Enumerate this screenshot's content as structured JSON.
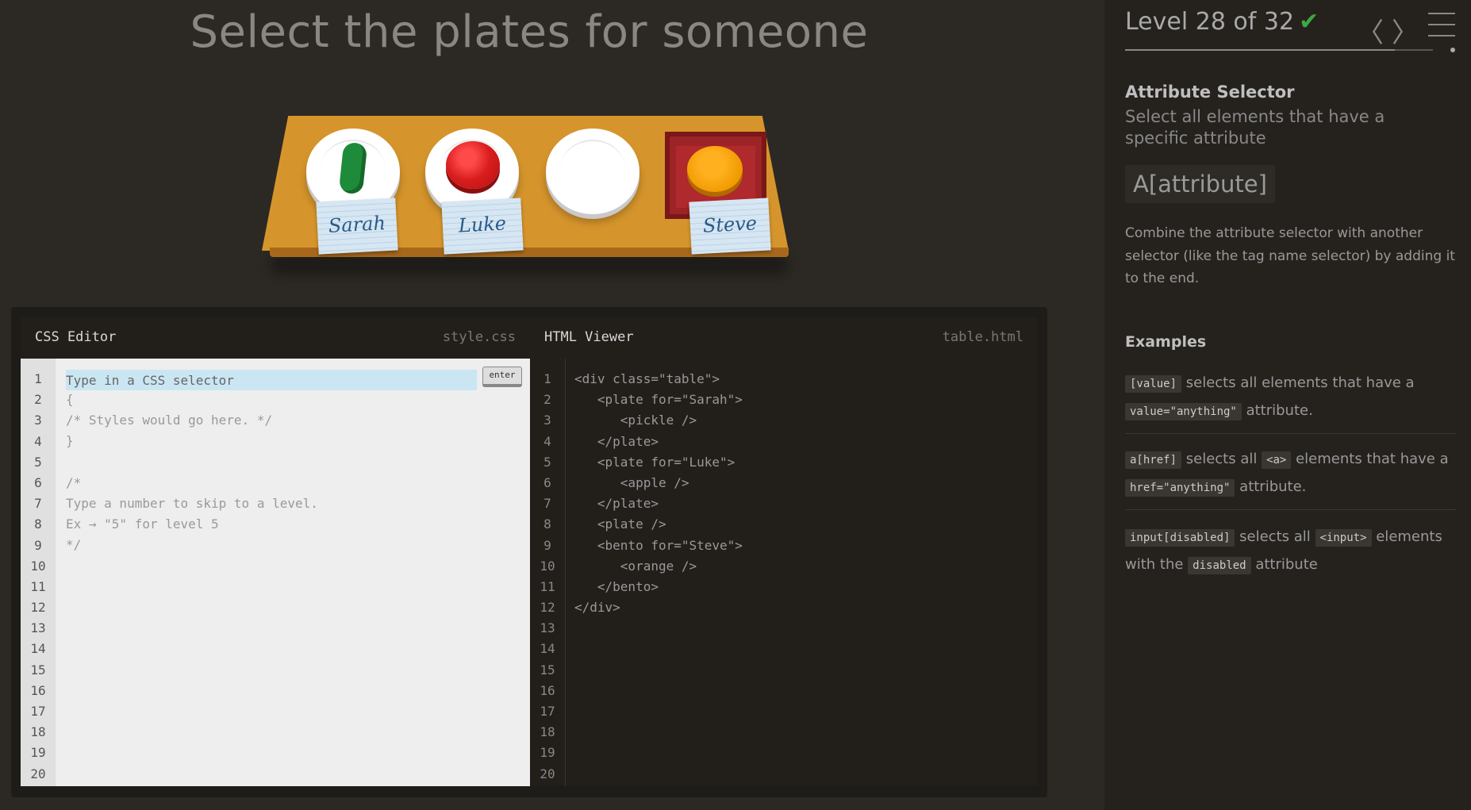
{
  "game": {
    "title": "Select the plates for someone",
    "nametags": [
      "Sarah",
      "Luke",
      "Steve"
    ]
  },
  "css_editor": {
    "title": "CSS Editor",
    "filename": "style.css",
    "placeholder": "Type in a CSS selector",
    "enter_label": "enter",
    "line_numbers": [
      "1",
      "2",
      "3",
      "4",
      "5",
      "6",
      "7",
      "8",
      "9",
      "10",
      "11",
      "12",
      "13",
      "14",
      "15",
      "16",
      "17",
      "18",
      "19",
      "20"
    ],
    "code_lines": [
      "{",
      "/* Styles would go here. */",
      "}",
      "",
      "/*",
      "Type a number to skip to a level.",
      "Ex → \"5\" for level 5",
      "*/"
    ]
  },
  "html_viewer": {
    "title": "HTML Viewer",
    "filename": "table.html",
    "line_numbers": [
      "1",
      "2",
      "3",
      "4",
      "5",
      "6",
      "7",
      "8",
      "9",
      "10",
      "11",
      "12",
      "13",
      "14",
      "15",
      "16",
      "17",
      "18",
      "19",
      "20"
    ],
    "code_lines": [
      "<div class=\"table\">",
      "   <plate for=\"Sarah\">",
      "      <pickle />",
      "   </plate>",
      "   <plate for=\"Luke\">",
      "      <apple />",
      "   </plate>",
      "   <plate />",
      "   <bento for=\"Steve\">",
      "      <orange />",
      "   </bento>",
      "</div>"
    ]
  },
  "sidebar": {
    "level_title": "Level 28 of 32",
    "check_glyph": "✔",
    "prev_glyph": "〈",
    "next_glyph": "〉",
    "progress_fraction": 0.875,
    "selector_name": "Attribute Selector",
    "selector_desc": "Select all elements that have a specific attribute",
    "syntax": "A[attribute]",
    "hint": "Combine the attribute selector with another selector (like the tag name selector) by adding it to the end.",
    "examples_title": "Examples",
    "examples": [
      {
        "code1": "[value]",
        "text1": " selects all elements that have a ",
        "code2": "value=\"anything\"",
        "text2": " attribute."
      },
      {
        "code1": "a[href]",
        "text1": " selects all ",
        "code2": "<a>",
        "text2": " elements that have a ",
        "code3": "href=\"anything\"",
        "text3": " attribute."
      },
      {
        "code1": "input[disabled]",
        "text1": " selects all ",
        "code2": "<input>",
        "text2": " elements with the ",
        "code3": "disabled",
        "text3": " attribute"
      }
    ]
  },
  "colors": {
    "background": "#2c2924",
    "sidebar": "#25221e",
    "table": "#d6952c",
    "check": "#3ca744",
    "input_highlight": "#cae6f3"
  }
}
